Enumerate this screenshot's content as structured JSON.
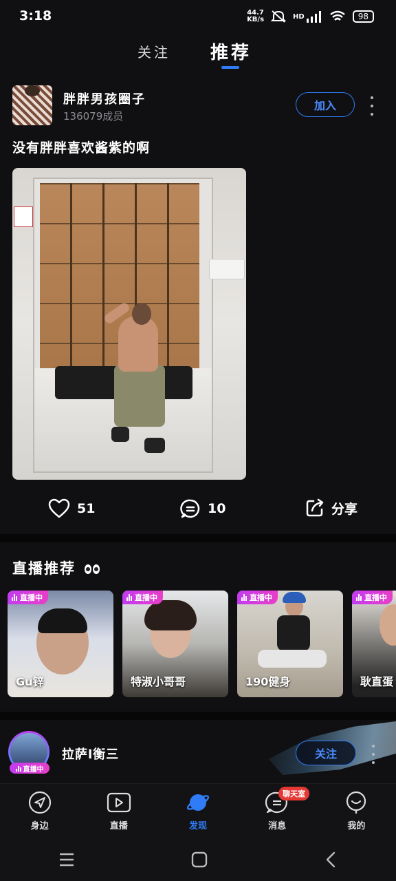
{
  "status_bar": {
    "time": "3:18",
    "speed_value": "44.7",
    "speed_unit": "KB/s",
    "network": "HD",
    "battery": "98"
  },
  "top_tabs": [
    {
      "label": "关注",
      "active": false
    },
    {
      "label": "推荐",
      "active": true
    }
  ],
  "post": {
    "group_name": "胖胖男孩圈子",
    "group_members": "136079成员",
    "join_label": "加入",
    "text": "没有胖胖喜欢酱紫的啊",
    "likes": "51",
    "comments": "10",
    "share_label": "分享"
  },
  "live_section": {
    "title": "直播推荐",
    "badge_text": "直播中",
    "cards": [
      {
        "name": "Gu锌"
      },
      {
        "name": "特淑小哥哥"
      },
      {
        "name": "190健身"
      },
      {
        "name": "耿直蛋"
      }
    ]
  },
  "live_user": {
    "name": "拉萨l衡三",
    "badge_text": "直播中",
    "follow_label": "关注"
  },
  "bottom_nav": [
    {
      "label": "身边",
      "icon": "location-arrow-icon",
      "active": false
    },
    {
      "label": "直播",
      "icon": "video-camera-icon",
      "active": false
    },
    {
      "label": "发现",
      "icon": "planet-icon",
      "active": true
    },
    {
      "label": "消息",
      "icon": "chat-bubble-icon",
      "active": false,
      "badge": "聊天室"
    },
    {
      "label": "我的",
      "icon": "profile-icon",
      "active": false
    }
  ],
  "colors": {
    "accent": "#2f7cf6",
    "live_badge": "#d33ee0",
    "background": "#101012",
    "badge_red": "#e53935"
  }
}
